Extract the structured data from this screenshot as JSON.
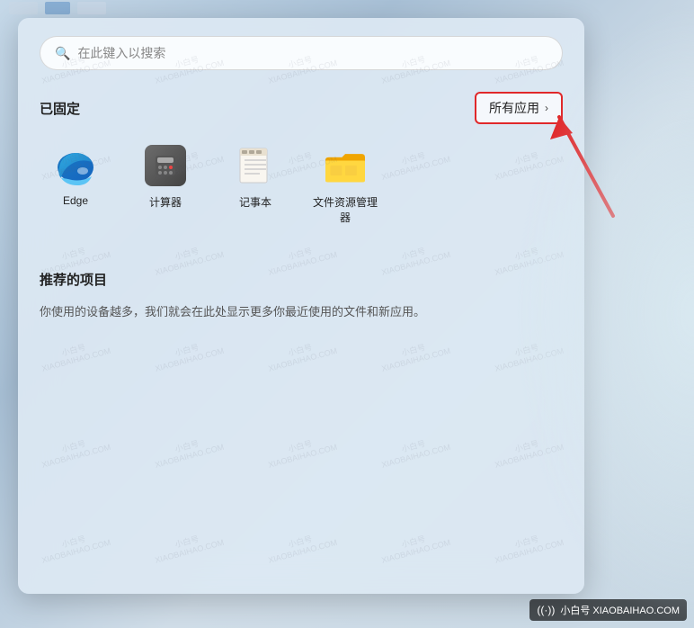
{
  "desktop": {
    "background_colors": [
      "#c5d8e8",
      "#a8c0d6",
      "#d0dde8"
    ]
  },
  "search": {
    "placeholder": "在此键入以搜索",
    "icon": "🔍"
  },
  "pinned_section": {
    "title": "已固定",
    "all_apps_label": "所有应用",
    "all_apps_chevron": "›"
  },
  "apps": [
    {
      "id": "edge",
      "label": "Edge",
      "type": "edge"
    },
    {
      "id": "calculator",
      "label": "计算器",
      "type": "calculator"
    },
    {
      "id": "notepad",
      "label": "记事本",
      "type": "notepad"
    },
    {
      "id": "explorer",
      "label": "文件资源管理器",
      "type": "explorer"
    }
  ],
  "recommended_section": {
    "title": "推荐的项目",
    "description": "你使用的设备越多，我们就会在此处显示更多你最近使用的文件和新应用。"
  },
  "watermark": {
    "text": "小白号 XIAOBAIHAO.COM"
  },
  "bottom_badge": {
    "wifi_symbol": "((·))",
    "text": "小白号 XIAOBAIHAO.COM"
  }
}
